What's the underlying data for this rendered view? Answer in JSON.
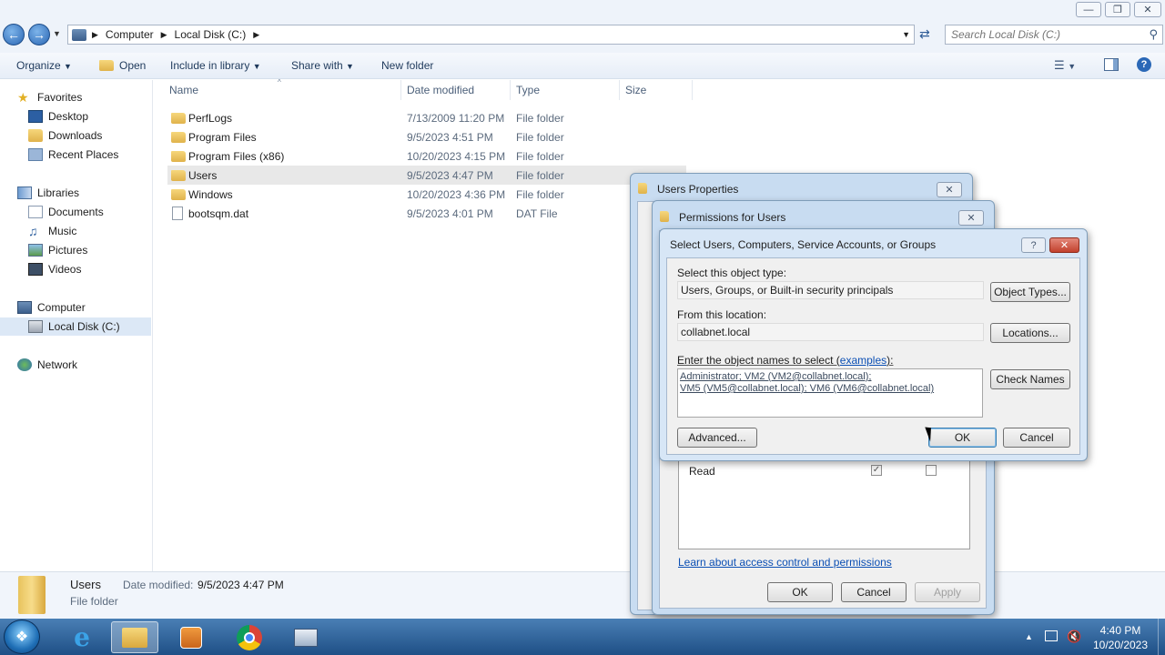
{
  "window": {
    "minimize_icon": "minimize-icon",
    "maximize_icon": "restore-icon",
    "close_icon": "close-icon"
  },
  "address": {
    "crumbs": [
      "Computer",
      "Local Disk (C:)"
    ],
    "search_placeholder": "Search Local Disk (C:)"
  },
  "toolbar": {
    "organize": "Organize",
    "open": "Open",
    "include": "Include in library",
    "share": "Share with",
    "new_folder": "New folder"
  },
  "nav": {
    "favorites": "Favorites",
    "desktop": "Desktop",
    "downloads": "Downloads",
    "recent": "Recent Places",
    "libraries": "Libraries",
    "documents": "Documents",
    "music": "Music",
    "pictures": "Pictures",
    "videos": "Videos",
    "computer": "Computer",
    "localdisk": "Local Disk (C:)",
    "network": "Network"
  },
  "columns": {
    "name": "Name",
    "date": "Date modified",
    "type": "Type",
    "size": "Size"
  },
  "files": [
    {
      "name": "PerfLogs",
      "date": "7/13/2009 11:20 PM",
      "type": "File folder"
    },
    {
      "name": "Program Files",
      "date": "9/5/2023 4:51 PM",
      "type": "File folder"
    },
    {
      "name": "Program Files (x86)",
      "date": "10/20/2023 4:15 PM",
      "type": "File folder"
    },
    {
      "name": "Users",
      "date": "9/5/2023 4:47 PM",
      "type": "File folder"
    },
    {
      "name": "Windows",
      "date": "10/20/2023 4:36 PM",
      "type": "File folder"
    },
    {
      "name": "bootsqm.dat",
      "date": "9/5/2023 4:01 PM",
      "type": "DAT File"
    }
  ],
  "details": {
    "name": "Users",
    "date_label": "Date modified:",
    "date": "9/5/2023 4:47 PM",
    "type": "File folder"
  },
  "props_dialog": {
    "title": "Users Properties"
  },
  "perm_dialog": {
    "title": "Permissions for Users",
    "read_label": "Read",
    "learn_link": "Learn about access control and permissions",
    "ok": "OK",
    "cancel": "Cancel",
    "apply": "Apply"
  },
  "select_dialog": {
    "title": "Select Users, Computers, Service Accounts, or Groups",
    "object_type_label": "Select this object type:",
    "object_type_value": "Users, Groups, or Built-in security principals",
    "object_types_btn": "Object Types...",
    "location_label": "From this location:",
    "location_value": "collabnet.local",
    "locations_btn": "Locations...",
    "names_label": "Enter the object names to select (",
    "examples_link": "examples",
    "names_label_end": "):",
    "names_line1": "Administrator; VM2 (VM2@collabnet.local);",
    "names_line2": "VM5 (VM5@collabnet.local); VM6 (VM6@collabnet.local)",
    "check_names_btn": "Check Names",
    "advanced_btn": "Advanced...",
    "ok": "OK",
    "cancel": "Cancel"
  },
  "clock": {
    "time": "4:40 PM",
    "date": "10/20/2023"
  }
}
